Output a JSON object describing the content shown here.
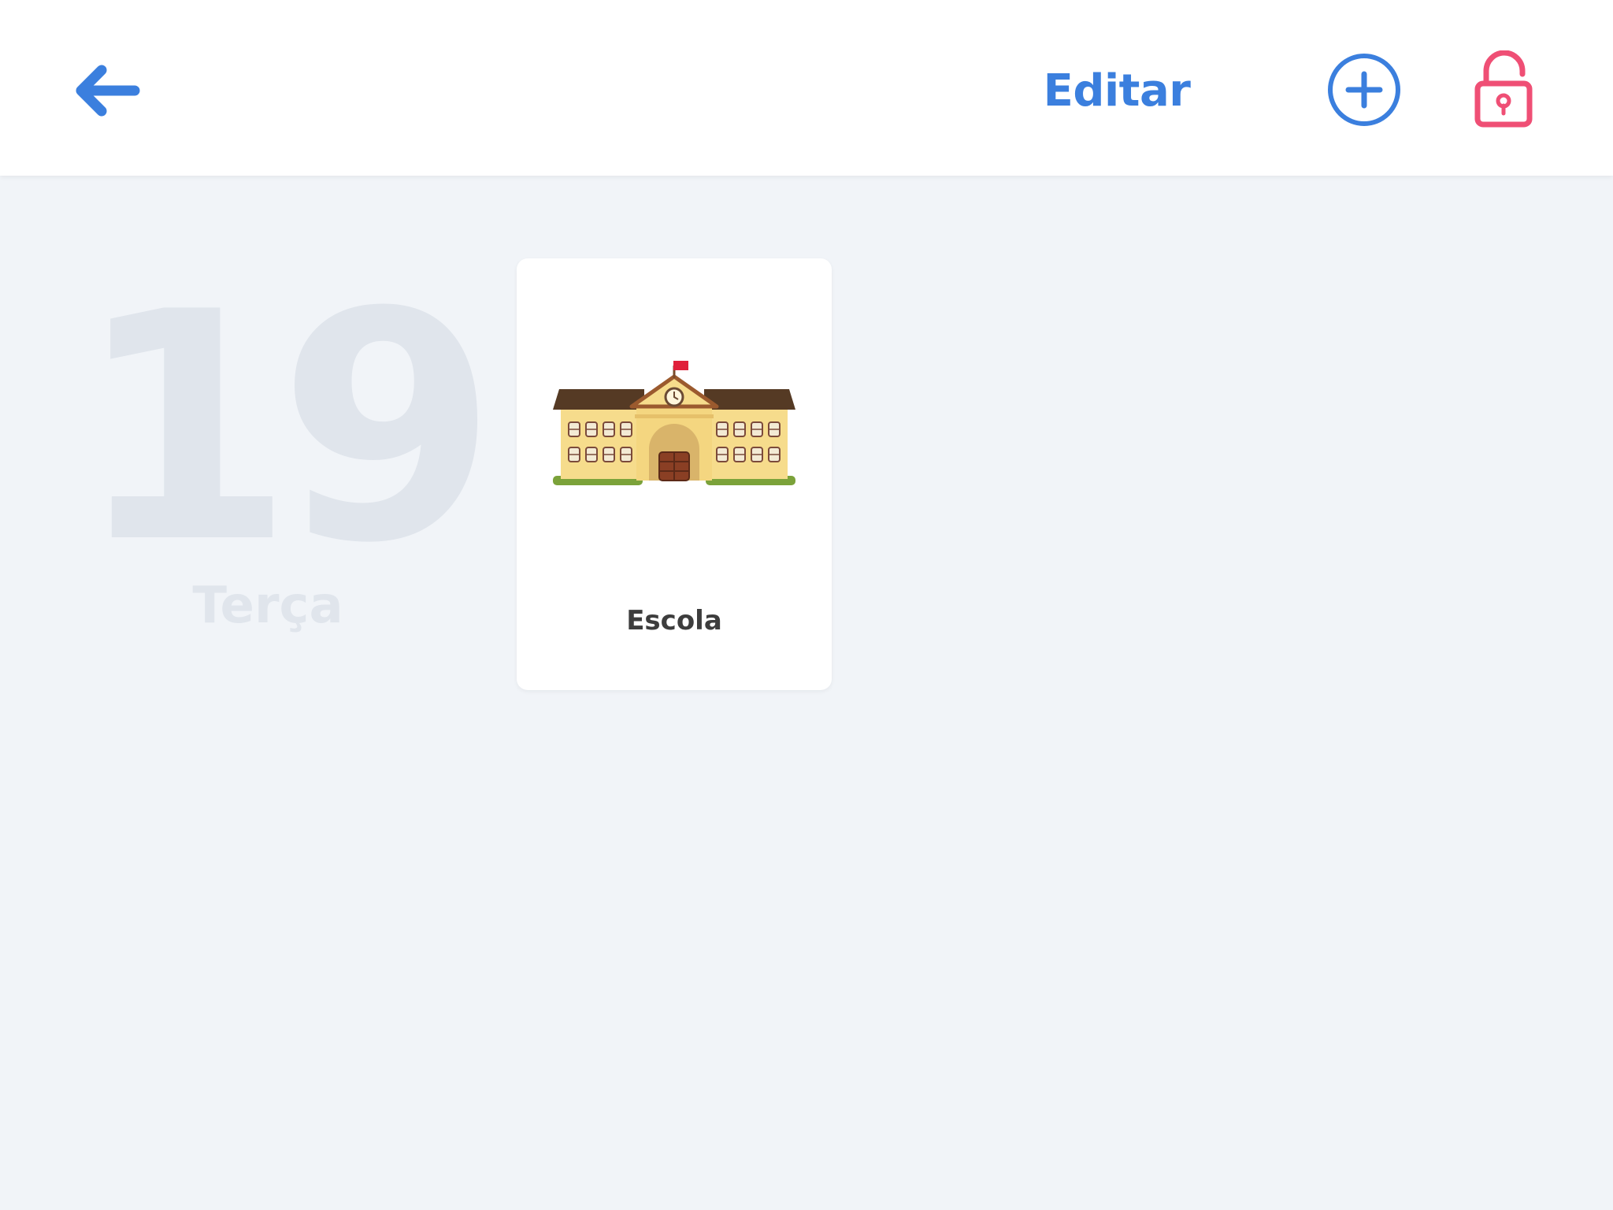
{
  "header": {
    "back_icon": "arrow-left-icon",
    "edit_label": "Editar",
    "add_icon": "plus-circle-icon",
    "lock_icon": "unlock-icon"
  },
  "day": {
    "number": "19",
    "weekday": "Terça"
  },
  "activities": [
    {
      "label": "Escola",
      "icon": "school-building-icon"
    }
  ],
  "colors": {
    "accent_blue": "#3b7fde",
    "lock_red": "#ef4f75",
    "background": "#f1f4f8",
    "watermark": "#e0e5ec",
    "card_text": "#3d3d3d"
  }
}
